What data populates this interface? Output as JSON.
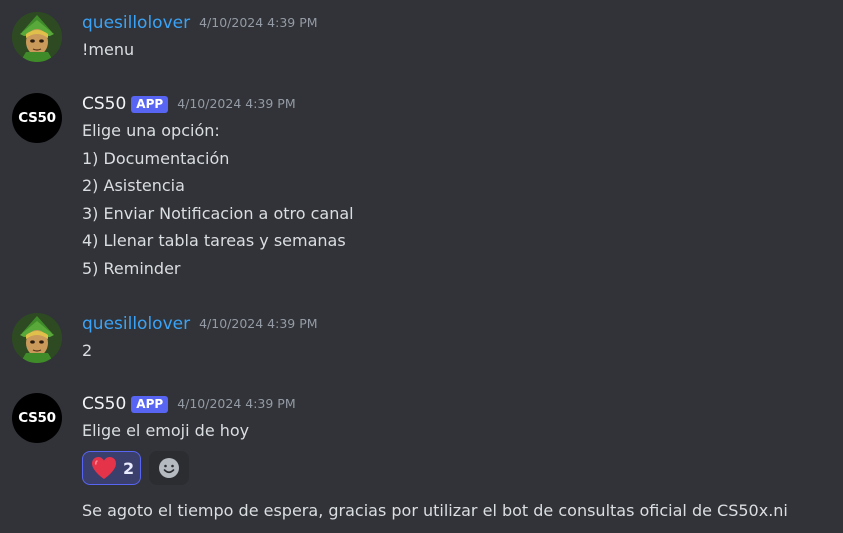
{
  "messages": [
    {
      "author": "quesillolover",
      "timestamp": "4/10/2024 4:39 PM",
      "lines": [
        "!menu"
      ]
    },
    {
      "author": "CS50",
      "badge": "APP",
      "avatar_text": "CS50",
      "timestamp": "4/10/2024 4:39 PM",
      "lines": [
        "Elige una opción:",
        "1) Documentación",
        "2) Asistencia",
        "3) Enviar Notificacion a otro canal",
        "4) Llenar tabla tareas y semanas",
        "5) Reminder"
      ]
    },
    {
      "author": "quesillolover",
      "timestamp": "4/10/2024 4:39 PM",
      "lines": [
        "2"
      ]
    },
    {
      "author": "CS50",
      "badge": "APP",
      "avatar_text": "CS50",
      "timestamp": "4/10/2024 4:39 PM",
      "lines": [
        "Elige el emoji de hoy"
      ],
      "reaction": {
        "emoji": "heart-icon",
        "count": "2"
      },
      "followup": "Se agoto el tiempo de espera, gracias por utilizar el bot de consultas oficial de CS50x.ni"
    }
  ],
  "colors": {
    "background": "#313338",
    "user_name": "#3ba3f7",
    "bot_name": "#f2f3f5",
    "badge": "#5865f2",
    "timestamp": "#949ba4",
    "text": "#dbdee1",
    "reaction_bg": "#3b3f6b",
    "reaction_border": "#5865f2",
    "heart": "#e5334a"
  }
}
